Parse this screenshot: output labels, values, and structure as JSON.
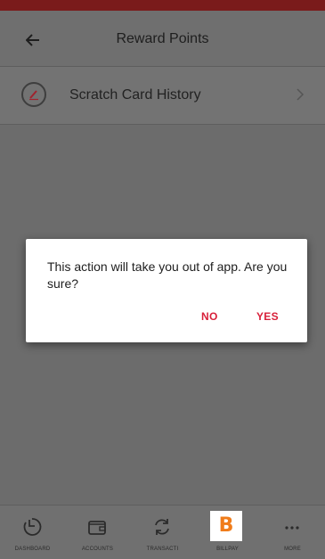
{
  "header": {
    "title": "Reward Points"
  },
  "list": {
    "items": [
      {
        "label": "Scratch Card History",
        "icon": "edit-circle-icon"
      }
    ]
  },
  "dialog": {
    "message": "This action will take you out of app. Are you sure?",
    "no_label": "NO",
    "yes_label": "YES"
  },
  "bottom_nav": {
    "items": [
      {
        "label": "DASHBOARD",
        "icon": "dashboard-icon"
      },
      {
        "label": "ACCOUNTS",
        "icon": "wallet-icon"
      },
      {
        "label": "TRANSACTI",
        "icon": "transfer-icon"
      },
      {
        "label": "BILLPAY",
        "icon": "billpay-logo-icon",
        "logo_text": "B"
      },
      {
        "label": "MORE",
        "icon": "more-icon"
      }
    ]
  },
  "colors": {
    "accent": "#d8203a",
    "status_bar": "#7a1b1b",
    "billpay_logo": "#f07c1a",
    "overlay": "#6f6f6f"
  }
}
